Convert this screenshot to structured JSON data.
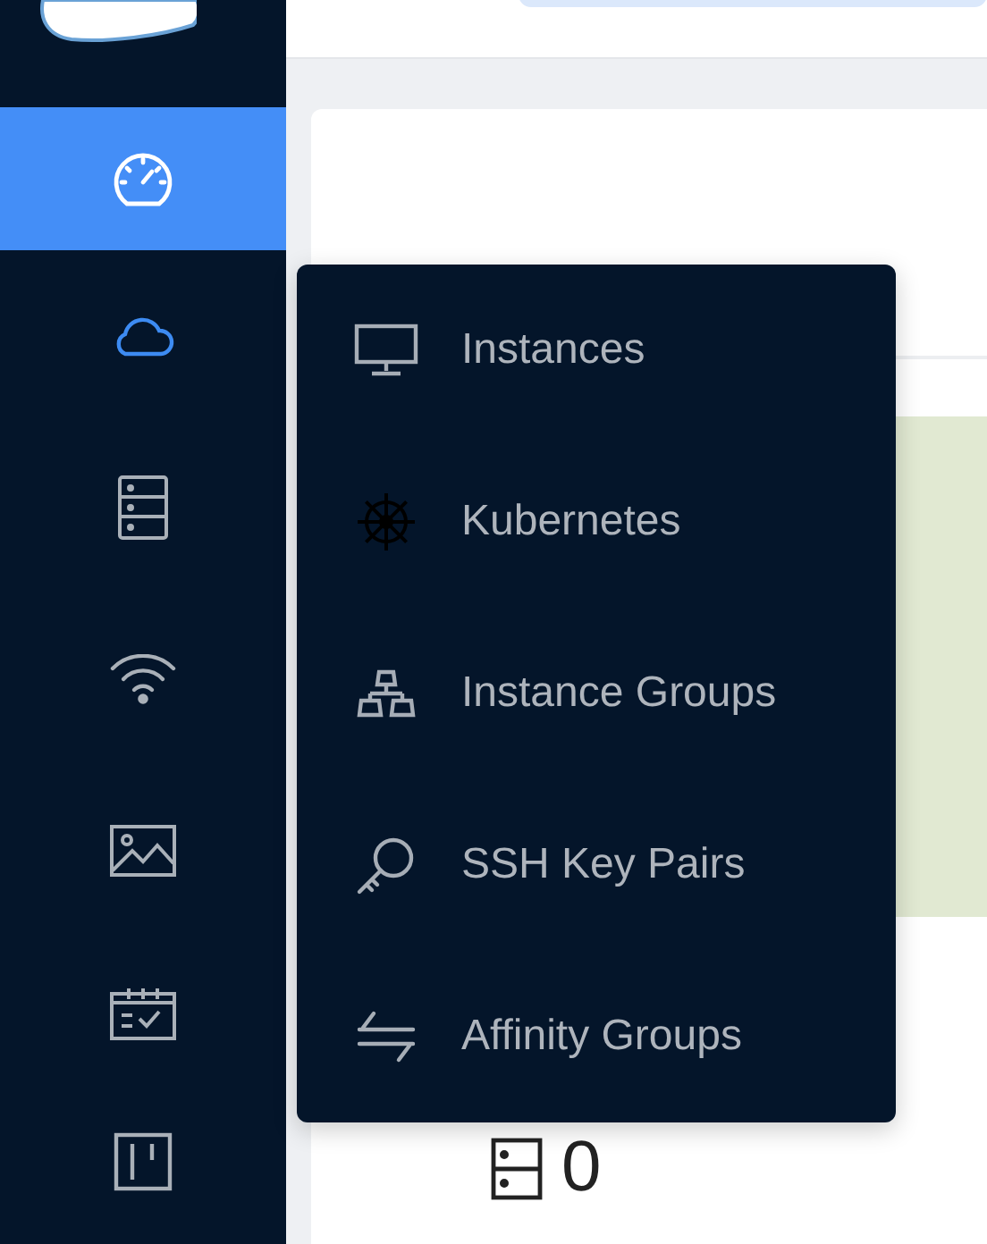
{
  "sidebar": {
    "items": [
      {
        "selected": true,
        "expanded": false
      },
      {
        "selected": false,
        "expanded": true
      },
      {
        "selected": false,
        "expanded": false
      },
      {
        "selected": false,
        "expanded": false
      },
      {
        "selected": false,
        "expanded": false
      },
      {
        "selected": false,
        "expanded": false
      },
      {
        "selected": false,
        "expanded": false
      }
    ]
  },
  "flyout_menu": {
    "items": [
      {
        "label": "Instances"
      },
      {
        "label": "Kubernetes"
      },
      {
        "label": "Instance Groups"
      },
      {
        "label": "SSH Key Pairs"
      },
      {
        "label": "Affinity Groups"
      }
    ]
  },
  "stat": {
    "value": "0"
  }
}
